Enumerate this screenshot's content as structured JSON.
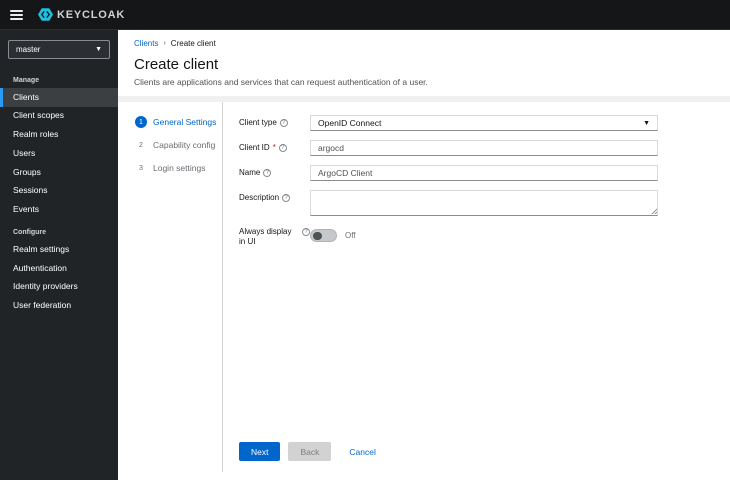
{
  "topbar": {
    "logo_text": "KEYCLOAK"
  },
  "sidebar": {
    "realm_selector": {
      "value": "master"
    },
    "sections": [
      {
        "label": "Manage",
        "items": [
          {
            "label": "Clients",
            "selected": true
          },
          {
            "label": "Client scopes",
            "selected": false
          },
          {
            "label": "Realm roles",
            "selected": false
          },
          {
            "label": "Users",
            "selected": false
          },
          {
            "label": "Groups",
            "selected": false
          },
          {
            "label": "Sessions",
            "selected": false
          },
          {
            "label": "Events",
            "selected": false
          }
        ]
      },
      {
        "label": "Configure",
        "items": [
          {
            "label": "Realm settings",
            "selected": false
          },
          {
            "label": "Authentication",
            "selected": false
          },
          {
            "label": "Identity providers",
            "selected": false
          },
          {
            "label": "User federation",
            "selected": false
          }
        ]
      }
    ]
  },
  "page": {
    "breadcrumb": {
      "root": "Clients",
      "current": "Create client"
    },
    "title": "Create client",
    "subtitle": "Clients are applications and services that can request authentication of a user."
  },
  "wizard": {
    "steps": [
      {
        "number": "1",
        "label": "General Settings",
        "active": true
      },
      {
        "number": "2",
        "label": "Capability config",
        "active": false
      },
      {
        "number": "3",
        "label": "Login settings",
        "active": false
      }
    ],
    "form": {
      "client_type": {
        "label": "Client type",
        "value": "OpenID Connect"
      },
      "client_id": {
        "label": "Client ID",
        "required_mark": "*",
        "value": "argocd"
      },
      "name": {
        "label": "Name",
        "value": "ArgoCD Client"
      },
      "description": {
        "label": "Description",
        "value": ""
      },
      "always_display": {
        "label": "Always display in UI",
        "state_label": "Off",
        "on": false
      }
    },
    "footer": {
      "next": "Next",
      "back": "Back",
      "cancel": "Cancel"
    }
  },
  "colors": {
    "accent": "#0066cc",
    "topbar_bg": "#141618",
    "sidebar_bg": "#212427",
    "selected_item_bg": "#3c3f42",
    "selected_item_border": "#2b9af3",
    "logo_cyan": "#1fc0e0",
    "divider": "#d2d2d2"
  }
}
